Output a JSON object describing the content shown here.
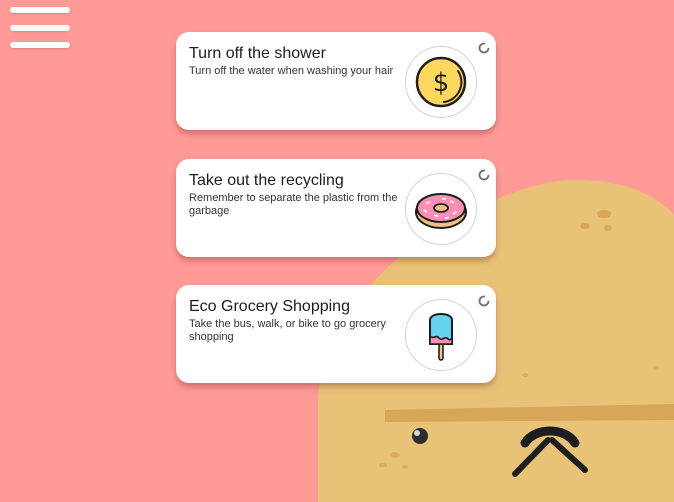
{
  "menu": {
    "icon": "hamburger-menu-icon"
  },
  "tasks": [
    {
      "title": "Turn off the shower",
      "description": "Turn off the water when washing your hair",
      "icon": "dollar-coin-icon"
    },
    {
      "title": "Take out the recycling",
      "description": "Remember to separate the plastic from the garbage",
      "icon": "donut-icon"
    },
    {
      "title": "Eco Grocery Shopping",
      "description": "Take the bus, walk, or bike to go grocery shopping",
      "icon": "popsicle-icon"
    }
  ],
  "colors": {
    "background": "#ff9a97",
    "card": "#ffffff",
    "potato": "#e8c277",
    "coin": "#ffd75e",
    "donut_frosting": "#ff8fb5",
    "popsicle": "#64d3f0"
  }
}
